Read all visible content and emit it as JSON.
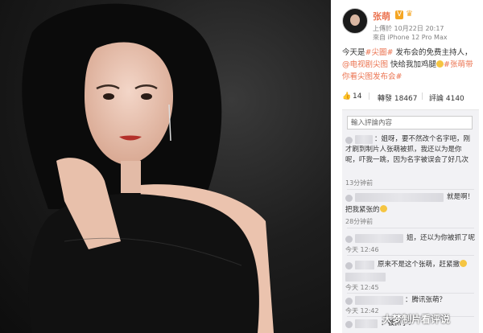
{
  "user": {
    "name": "张萌",
    "badge": "V"
  },
  "post": {
    "meta_time": "上傳於 10月22日 20:17",
    "meta_device": "來自 iPhone 12 Pro Max",
    "text_1": "今天是",
    "tag_1": "#尖圖#",
    "text_2": " 发布会的免费主持人，",
    "tag_2": "@电视剧尖图",
    "text_3": " 快给我加鸡腿",
    "tag_3": "#张萌带你看尖图发布会#"
  },
  "actions": {
    "likes": "14",
    "shares_label": "轉發 18467",
    "comments_label": "評論 4140"
  },
  "comment_input": {
    "placeholder": "輸入評論內容"
  },
  "comments": [
    {
      "text": "：姐呀，要不然改个名字吧，刚才刷到制片人张萌被抓，我还以为是你呢，吓我一跳，因为名字被误会了好几次",
      "time": "13分钟前"
    },
    {
      "text": "就是啊！",
      "reply": "把我紧张的",
      "time": "28分钟前"
    },
    {
      "text": "姐，还以为你被抓了呢",
      "time": "今天 12:46"
    },
    {
      "text": "原来不是这个张萌，赶紧撤",
      "time": "今天 12:45"
    },
    {
      "text": "：腾讯张萌？",
      "time": "今天 12:42"
    },
    {
      "text": "：被抓了？"
    }
  ],
  "watermark": "大梦制片看评说"
}
